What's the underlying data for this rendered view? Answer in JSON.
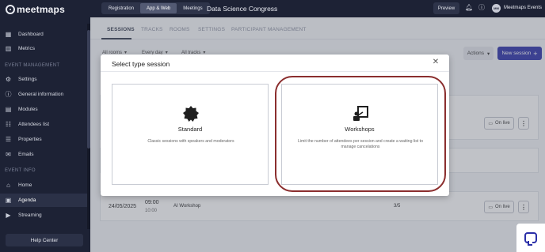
{
  "brand": {
    "logo_text": "meetmaps"
  },
  "sidebar": {
    "items_top": [
      {
        "label": "Dashboard",
        "icon": "grid-icon"
      },
      {
        "label": "Metrics",
        "icon": "chart-icon"
      }
    ],
    "section_event_management": "EVENT MANAGEMENT",
    "items_management": [
      {
        "label": "Settings",
        "icon": "gear-icon"
      },
      {
        "label": "General information",
        "icon": "info-icon"
      },
      {
        "label": "Modules",
        "icon": "modules-icon"
      },
      {
        "label": "Attendees list",
        "icon": "users-icon"
      },
      {
        "label": "Properties",
        "icon": "properties-icon"
      },
      {
        "label": "Emails",
        "icon": "mail-icon"
      }
    ],
    "section_event_info": "EVENT INFO",
    "items_info": [
      {
        "label": "Home",
        "icon": "home-icon"
      },
      {
        "label": "Agenda",
        "icon": "calendar-icon"
      },
      {
        "label": "Streaming",
        "icon": "play-icon"
      }
    ],
    "help_center": "Help Center"
  },
  "topbar": {
    "segments": [
      "Registration",
      "App & Web",
      "Meetings"
    ],
    "active_segment": "App & Web",
    "event_name": "Data Science Congress",
    "preview": "Preview",
    "user_initials": "MM",
    "user_name": "Meetmaps Events"
  },
  "tabs": [
    "SESSIONS",
    "TRACKS",
    "ROOMS",
    "SETTINGS",
    "PARTICIPANT MANAGEMENT"
  ],
  "filters": [
    "All rooms",
    "Every day",
    "All tracks"
  ],
  "actions_label": "Actions",
  "new_session_label": "New session",
  "row": {
    "date": "24/05/2025",
    "start": "09:00",
    "end": "10:00",
    "name": "AI Workshop",
    "capacity": "3/5",
    "live_label": "On live"
  },
  "modal": {
    "title": "Select type session",
    "options": [
      {
        "title": "Standard",
        "description": "Classic sessions with speakers and moderators",
        "icon": "gear-badge-icon"
      },
      {
        "title": "Workshops",
        "description": "Limit the number of attendees per session and create a waiting list to manage cancelations",
        "icon": "presenter-board-icon"
      }
    ]
  },
  "colors": {
    "sidebar_bg": "#1d2235",
    "primary": "#2b2fa8",
    "highlight_ring": "#8b2e2e"
  }
}
